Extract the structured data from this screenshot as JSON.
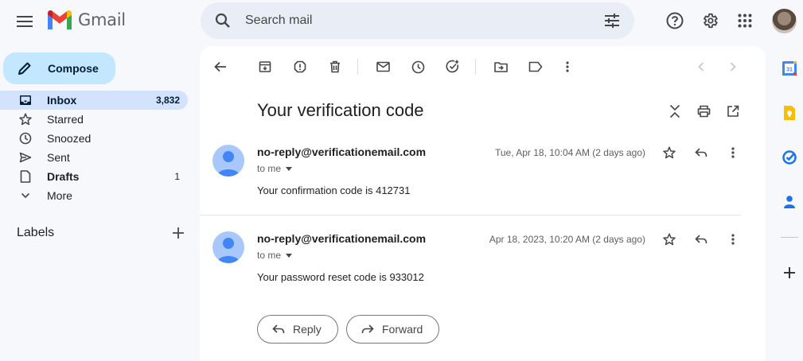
{
  "header": {
    "app_name": "Gmail",
    "search_placeholder": "Search mail"
  },
  "sidebar": {
    "compose_label": "Compose",
    "items": [
      {
        "label": "Inbox",
        "count": "3,832",
        "icon": "inbox-icon",
        "active": true
      },
      {
        "label": "Starred",
        "count": "",
        "icon": "star-icon"
      },
      {
        "label": "Snoozed",
        "count": "",
        "icon": "clock-icon"
      },
      {
        "label": "Sent",
        "count": "",
        "icon": "send-icon"
      },
      {
        "label": "Drafts",
        "count": "1",
        "icon": "draft-icon"
      },
      {
        "label": "More",
        "count": "",
        "icon": "chevron-down-icon"
      }
    ],
    "labels_heading": "Labels"
  },
  "thread": {
    "subject": "Your verification code",
    "messages": [
      {
        "sender": "no-reply@verificationemail.com",
        "recipient": "to me",
        "date": "Tue, Apr 18, 10:04 AM (2 days ago)",
        "body": "Your confirmation code is 412731"
      },
      {
        "sender": "no-reply@verificationemail.com",
        "recipient": "to me",
        "date": "Apr 18, 2023, 10:20 AM (2 days ago)",
        "body": "Your password reset code is 933012"
      }
    ],
    "reply_label": "Reply",
    "forward_label": "Forward"
  },
  "colors": {
    "compose_bg": "#c2e7ff",
    "active_nav_bg": "#d3e3fd",
    "search_bg": "#e9eef6",
    "avatar_bg": "#a8c7fa",
    "avatar_fg": "#4285f4"
  }
}
